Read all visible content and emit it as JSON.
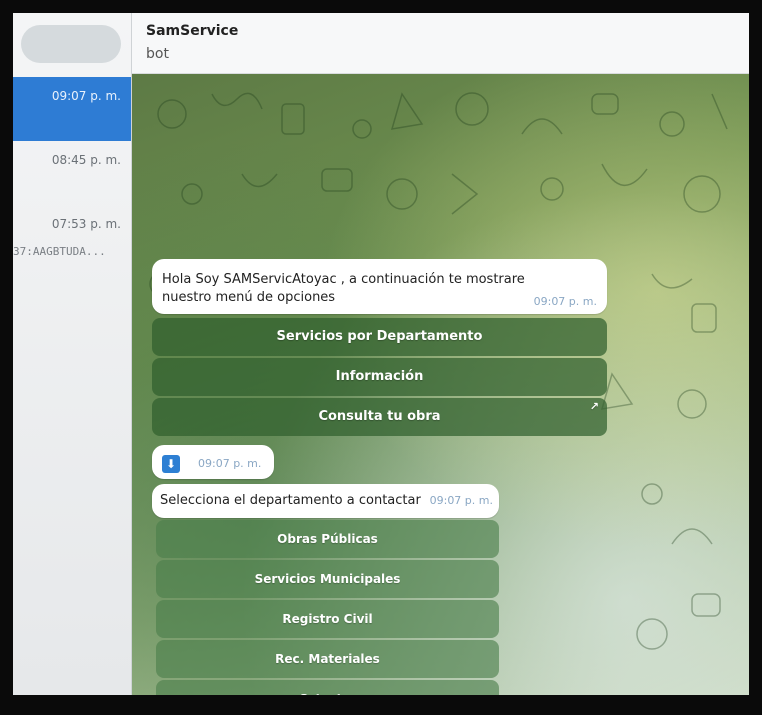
{
  "sidebar": {
    "chats": [
      {
        "time": "09:07 p. m.",
        "active": true
      },
      {
        "time": "08:45 p. m."
      },
      {
        "time": "07:53 p. m.",
        "preview": "37:AAGBTUDA..."
      }
    ]
  },
  "header": {
    "title": "SamService",
    "subtitle": "bot"
  },
  "messages": {
    "greeting": {
      "text": "Hola Soy SAMServicAtoyac  , a continuación te mostrare nuestro menú de opciones",
      "time": "09:07 p. m."
    },
    "main_keyboard": [
      {
        "label": "Servicios por Departamento"
      },
      {
        "label": "Información"
      },
      {
        "label": "Consulta tu obra",
        "icon": "arrow-up-right-icon"
      }
    ],
    "file_message": {
      "icon": "download-icon",
      "time": "09:07 p. m."
    },
    "department_prompt": {
      "text": "Selecciona el departamento a contactar",
      "time": "09:07 p. m."
    },
    "department_keyboard": [
      {
        "label": "Obras Públicas"
      },
      {
        "label": "Servicios Municipales"
      },
      {
        "label": "Registro Civil"
      },
      {
        "label": "Rec. Materiales"
      },
      {
        "label": "Catastro"
      }
    ]
  },
  "colors": {
    "accent": "#2e7cd4",
    "keyboard_button": "#30602e",
    "bubble": "#ffffff"
  }
}
